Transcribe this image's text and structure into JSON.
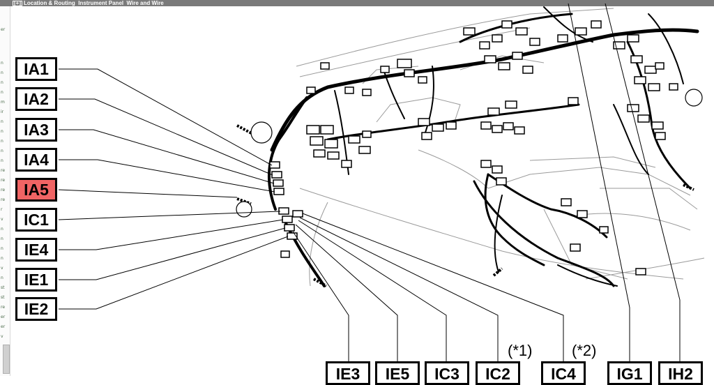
{
  "window": {
    "expander": "[+]",
    "title": "Location & Routing  Instrument Panel  Wire and Wire"
  },
  "left_connectors": [
    "IA1",
    "IA2",
    "IA3",
    "IA4",
    "IA5",
    "IC1",
    "IE4",
    "IE1",
    "IE2"
  ],
  "active_connector": "IA5",
  "bottom_connectors": [
    "IE3",
    "IE5",
    "IC3",
    "IC2",
    "IC4",
    "IG1",
    "IH2"
  ],
  "notes": [
    "(*1)",
    "(*2)"
  ],
  "colors": {
    "active": "#f06464",
    "outline": "#000000",
    "drawing": "#000000"
  }
}
